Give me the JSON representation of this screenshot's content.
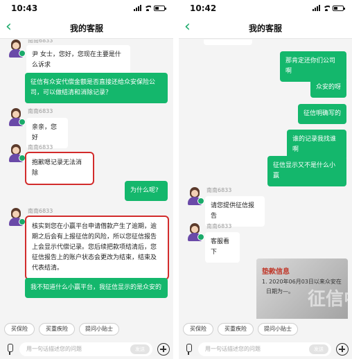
{
  "left": {
    "status_time": "10:43",
    "nav_title": "我的客服",
    "agent_name": "南南6833",
    "messages": [
      "尹 女士，您好，您现在主要是什么诉求",
      "征信有众安代偿金额是否直接还给众安保险公司，可以做结清和消除记录？",
      "亲亲，您好",
      "抱歉嗯记录无法消除",
      "为什么呢?",
      "核实到您在小赢平台申请借款产生了逾期，逾期之后会有上报征信的风险，所以您征信报告上会显示代偿记录。您后续把款项结清后，您征信报告上的账户状态会更改为结束，结束及代表结清。",
      "我不知道什么小赢平台，我征信显示的是众安的"
    ]
  },
  "right": {
    "status_time": "10:42",
    "nav_title": "我的客服",
    "agent_name": "南南6833",
    "messages": [
      "那肯定还你们公司啊",
      "众安的呀",
      "征信明确写的",
      "谁的记录我找谁啊",
      "征信显示又不是什么小赢",
      "请您提供征信报告",
      "客服看下"
    ],
    "image_title": "垫款信息",
    "image_line1": "1. 2020年06月03日以来众安在",
    "image_line2": "日期为—。",
    "image_stamp": "征信中"
  },
  "quick_replies": [
    "买保险",
    "买重疾险",
    "提问小贴士"
  ],
  "input_placeholder": "用一句话描述您的问题",
  "send_label": "发送"
}
